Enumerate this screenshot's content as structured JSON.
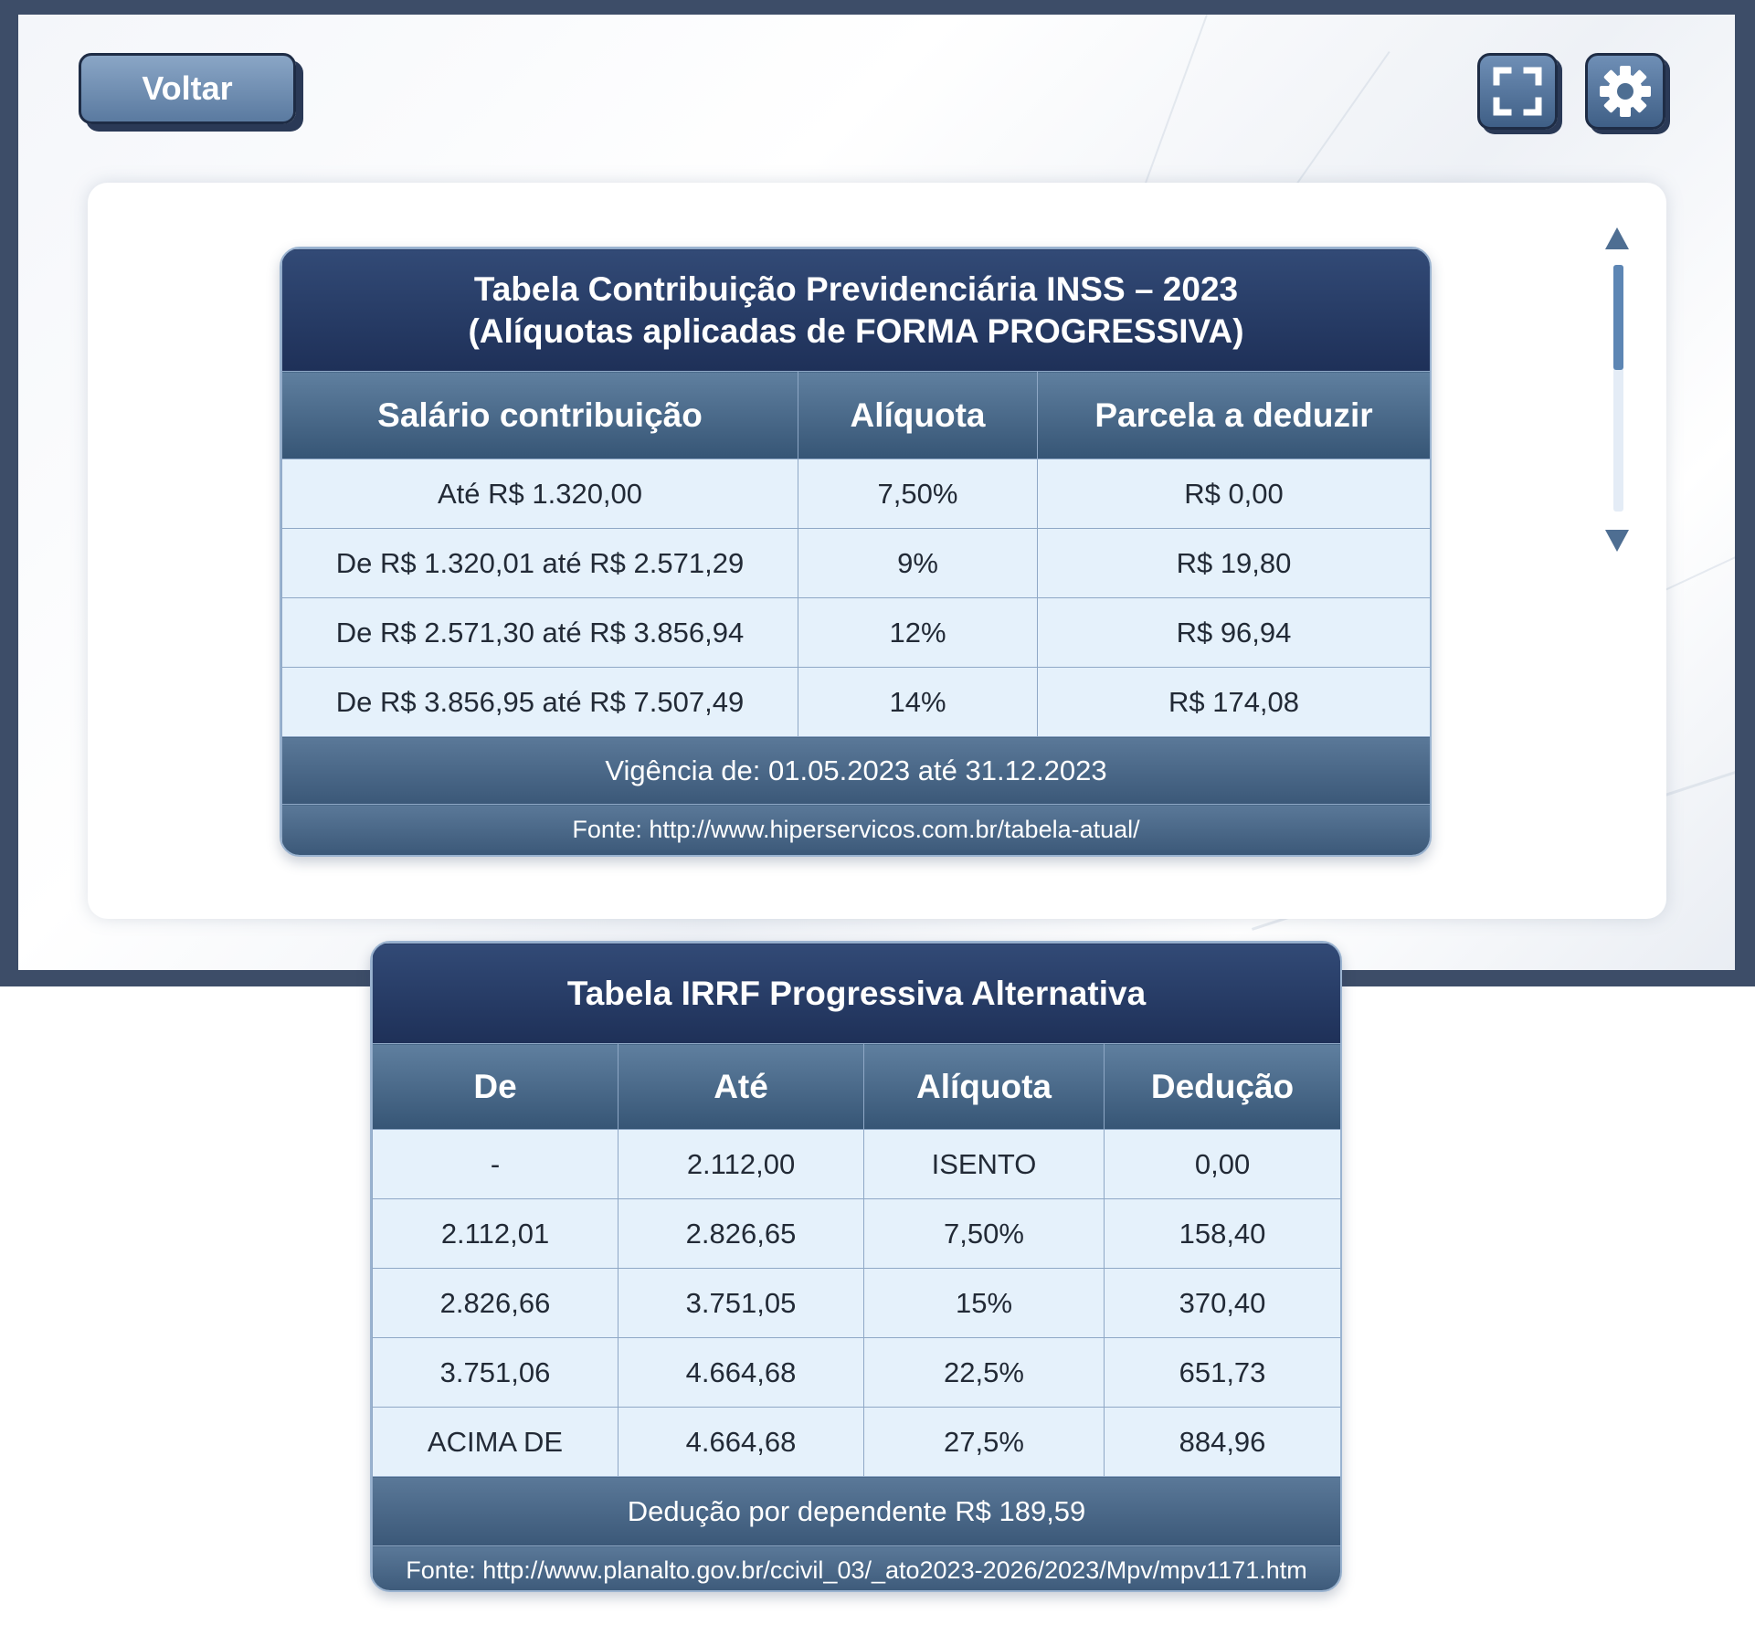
{
  "toolbar": {
    "back_label": "Voltar",
    "fullscreen_icon": "fullscreen-icon",
    "settings_icon": "gear-icon"
  },
  "colors": {
    "frame": "#3d4d68",
    "button": "#6f8fb6",
    "table_title": "#1e3058",
    "table_header": "#4b6a8a",
    "table_cell": "#e5f1fb"
  },
  "inss": {
    "title_line1": "Tabela Contribuição Previdenciária INSS – 2023",
    "title_line2": "(Alíquotas aplicadas de FORMA PROGRESSIVA)",
    "headers": [
      "Salário contribuição",
      "Alíquota",
      "Parcela a deduzir"
    ],
    "rows": [
      [
        "Até R$ 1.320,00",
        "7,50%",
        "R$ 0,00"
      ],
      [
        "De R$ 1.320,01 até R$ 2.571,29",
        "9%",
        "R$ 19,80"
      ],
      [
        "De R$ 2.571,30 até R$ 3.856,94",
        "12%",
        "R$ 96,94"
      ],
      [
        "De R$ 3.856,95 até R$ 7.507,49",
        "14%",
        "R$ 174,08"
      ]
    ],
    "validity": "Vigência de: 01.05.2023 até 31.12.2023",
    "source": "Fonte: http://www.hiperservicos.com.br/tabela-atual/"
  },
  "irrf": {
    "title": "Tabela IRRF Progressiva Alternativa",
    "headers": [
      "De",
      "Até",
      "Alíquota",
      "Dedução"
    ],
    "rows": [
      [
        "-",
        "2.112,00",
        "ISENTO",
        "0,00"
      ],
      [
        "2.112,01",
        "2.826,65",
        "7,50%",
        "158,40"
      ],
      [
        "2.826,66",
        "3.751,05",
        "15%",
        "370,40"
      ],
      [
        "3.751,06",
        "4.664,68",
        "22,5%",
        "651,73"
      ],
      [
        "ACIMA DE",
        "4.664,68",
        "27,5%",
        "884,96"
      ]
    ],
    "dependent": "Dedução por dependente R$ 189,59",
    "source": "Fonte: http://www.planalto.gov.br/ccivil_03/_ato2023-2026/2023/Mpv/mpv1171.htm"
  }
}
